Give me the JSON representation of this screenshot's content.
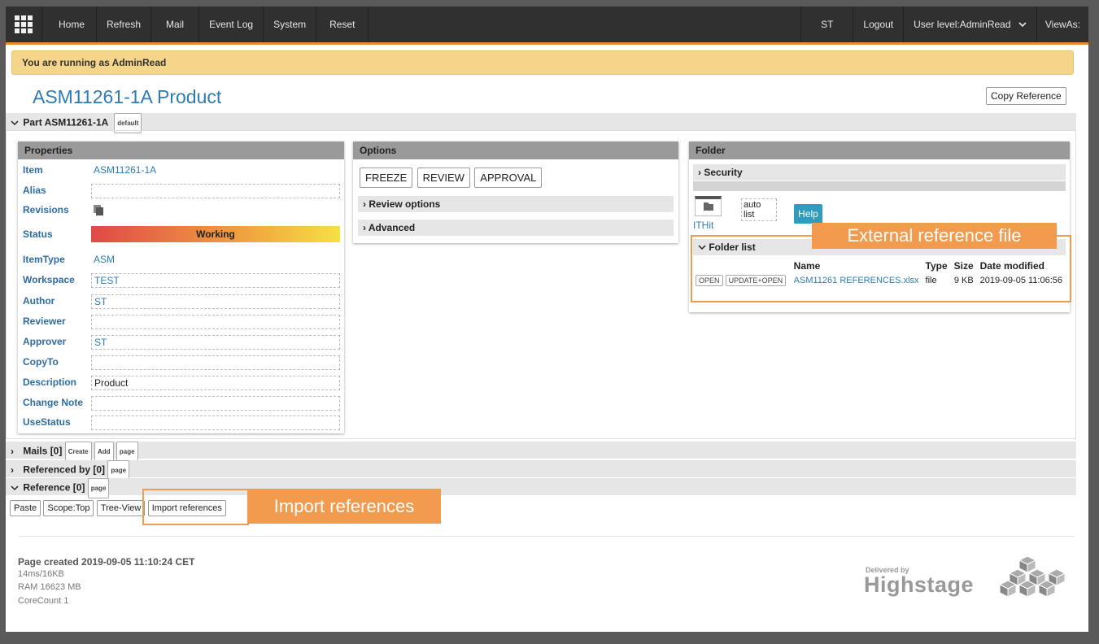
{
  "topbar": {
    "left_items": [
      "Home",
      "Refresh",
      "Mail",
      "Event Log",
      "System",
      "Reset"
    ],
    "right_items": [
      "ST",
      "Logout",
      "User level:AdminRead",
      "ViewAs:"
    ]
  },
  "banner": "You are running as AdminRead",
  "page_title": "ASM11261-1A Product",
  "copy_reference": "Copy Reference",
  "part_section": {
    "label": "Part ASM11261-1A",
    "badge": "default"
  },
  "properties": {
    "header": "Properties",
    "rows": [
      {
        "label": "Item",
        "value": "ASM11261-1A"
      },
      {
        "label": "Alias",
        "value": ""
      },
      {
        "label": "Revisions",
        "value": ""
      },
      {
        "label": "Status",
        "value": "Working"
      },
      {
        "label": "ItemType",
        "value": "ASM"
      },
      {
        "label": "Workspace",
        "value": "TEST"
      },
      {
        "label": "Author",
        "value": "ST"
      },
      {
        "label": "Reviewer",
        "value": ""
      },
      {
        "label": "Approver",
        "value": "ST"
      },
      {
        "label": "CopyTo",
        "value": ""
      },
      {
        "label": "Description",
        "value": "Product"
      },
      {
        "label": "Change Note",
        "value": ""
      },
      {
        "label": "UseStatus",
        "value": ""
      }
    ]
  },
  "options": {
    "header": "Options",
    "buttons": [
      "FREEZE",
      "REVIEW",
      "APPROVAL"
    ],
    "review_options": "Review options",
    "advanced": "Advanced"
  },
  "folder": {
    "header": "Folder",
    "security": "Security",
    "auto": "auto",
    "list": "list",
    "ithit": "ITHit",
    "help": "Help",
    "folder_list": "Folder list",
    "columns": [
      "Name",
      "Type",
      "Size",
      "Date modified"
    ],
    "file": {
      "open": "OPEN",
      "update_open": "UPDATE+OPEN",
      "name": "ASM11261 REFERENCES.xlsx",
      "type": "file",
      "size": "9 KB",
      "date": "2019-09-05 11:06:56"
    }
  },
  "sections": {
    "mails": {
      "label": "Mails [0]",
      "buttons": [
        "Create",
        "Add",
        "page"
      ]
    },
    "referenced_by": {
      "label": "Referenced by [0]",
      "buttons": [
        "page"
      ]
    },
    "reference": {
      "label": "Reference [0]",
      "buttons": [
        "page"
      ]
    }
  },
  "reference_toolbar": [
    "Paste",
    "Scope:Top",
    "Tree-View",
    "Import references"
  ],
  "annotations": {
    "external": "External reference file",
    "import": "Import references"
  },
  "footer": {
    "created": "Page created 2019-09-05 11:10:24 CET",
    "timing": "14ms/16KB",
    "ram": "RAM 16623 MB",
    "cores": "CoreCount 1"
  },
  "logo": {
    "delivered_by": "Delivered by",
    "brand": "Highstage"
  }
}
